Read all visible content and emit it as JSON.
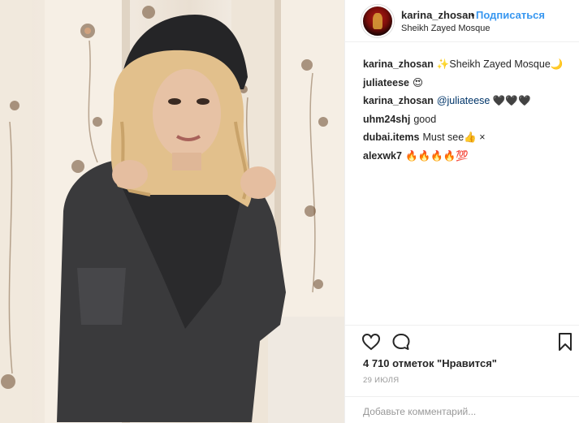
{
  "post": {
    "username": "karina_zhosan",
    "separator": "•",
    "follow_label": "Подписаться",
    "location": "Sheikh Zayed Mosque"
  },
  "comments": [
    {
      "user": "karina_zhosan",
      "text": "✨Sheikh Zayed Mosque🌙"
    },
    {
      "user": "juliateese",
      "text": "😍"
    },
    {
      "user": "karina_zhosan",
      "mention": "@juliateese",
      "text": "🖤🖤🖤"
    },
    {
      "user": "uhm24shj",
      "text": "good"
    },
    {
      "user": "dubai.items",
      "text": "Must see👍 ×"
    },
    {
      "user": "alexwk7",
      "text": "🔥🔥🔥🔥💯"
    }
  ],
  "likes_text": "4 710 отметок \"Нравится\"",
  "date_text": "29 ИЮЛЯ",
  "comment_placeholder": "Добавьте комментарий...",
  "icons": {
    "like": "heart-icon",
    "comment": "comment-bubble-icon",
    "save": "bookmark-icon"
  },
  "colors": {
    "link": "#3897f0",
    "mention": "#003569",
    "muted": "#999999"
  }
}
